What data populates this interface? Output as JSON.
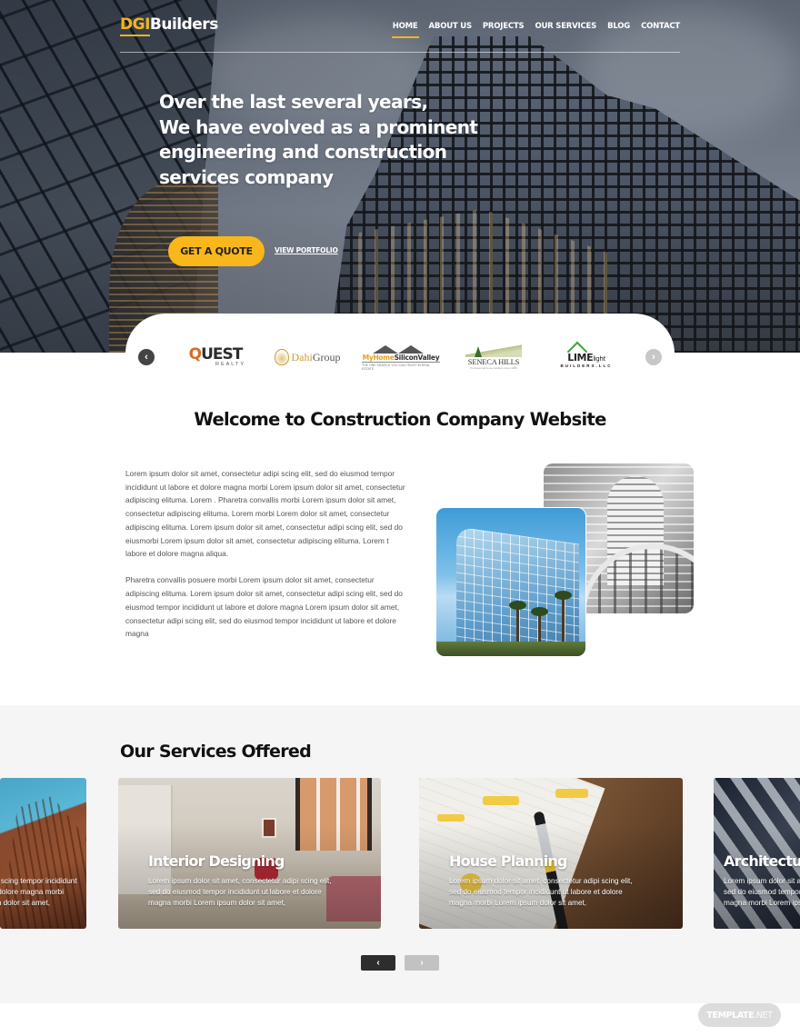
{
  "brand": {
    "logo_accent": "DGI",
    "logo_rest": "Builders",
    "accent_color": "#f9b71b"
  },
  "nav": {
    "items": [
      {
        "label": "HOME",
        "active": true
      },
      {
        "label": "ABOUT US",
        "active": false
      },
      {
        "label": "PROJECTS",
        "active": false
      },
      {
        "label": "OUR SERVICES",
        "active": false
      },
      {
        "label": "BLOG",
        "active": false
      },
      {
        "label": "CONTACT",
        "active": false
      }
    ]
  },
  "hero": {
    "headline_lines": [
      "Over the last several years,",
      "We have evolved as a prominent",
      "engineering and construction",
      "services company"
    ],
    "cta_primary": "GET A QUOTE",
    "cta_secondary": "VIEW PORTFOLIO"
  },
  "partners": {
    "prev_icon": "chevron-left-icon",
    "next_icon": "chevron-right-icon",
    "logos": [
      {
        "name": "QUEST REALTY",
        "line1": "QUEST",
        "line2": "REALTY"
      },
      {
        "name": "Dahi Group",
        "line1": "Dahi",
        "line2": "Group"
      },
      {
        "name": "MyHome SiliconValley",
        "line1": "MyHome",
        "line2": "SiliconValley",
        "tagline": "THE ONE SEARCH YOU CAN TRUST IN REAL ESTATE"
      },
      {
        "name": "SENECA HILLS",
        "line1": "SENECA HILLS",
        "tagline": "Professional home builders since 1985"
      },
      {
        "name": "LIMElight BUILDERS",
        "line1": "LIME",
        "line2": "light",
        "line3": "BUILDERS.LLC"
      }
    ]
  },
  "welcome": {
    "title": "Welcome to Construction Company Website",
    "paragraphs": [
      "Lorem ipsum dolor sit amet, consectetur adipi scing elit, sed do eiusmod tempor incididunt ut labore et dolore magna morbi Lorem ipsum dolor sit amet, consectetur adipiscing elituma. Lorem . Pharetra convallis morbi Lorem ipsum dolor sit amet, consectetur adipiscing elituma. Lorem morbi Lorem dolor sit amet, consectetur adipiscing elituma. Lorem ipsum dolor sit amet, consectetur adipi scing elit, sed do eiusmorbi Lorem ipsum dolor sit amet, consectetur adipiscing elituma. Lorem t labore et dolore magna aliqua.",
      "Pharetra convallis posuere morbi Lorem ipsum dolor sit amet, consectetur adipiscing elituma. Lorem ipsum dolor sit amet, consectetur adipi scing elit, sed do eiusmod tempor incididunt ut labore et dolore magna Lorem ipsum dolor sit amet, consectetur adipi scing elit, sed do eiusmod tempor incididunt ut labore et dolore magna"
    ]
  },
  "services": {
    "title": "Our Services Offered",
    "cards": [
      {
        "title": "",
        "text": "ectetur adipi scing tempor incididunt ut labore et dolore magna morbi Lorem ipsum dolor sit amet,"
      },
      {
        "title": "Interior Designing",
        "text": "Lorem ipsum dolor sit amet, consectetur adipi scing elit, sed do eiusmod tempor incididunt ut labore et dolore magna morbi Lorem ipsum dolor sit amet,"
      },
      {
        "title": "House Planning",
        "text": "Lorem ipsum dolor sit amet, consectetur adipi scing elit, sed do eiusmod tempor incididunt ut labore et dolore magna morbi Lorem ipsum dolor sit amet,"
      },
      {
        "title": "Architecture",
        "text": "Lorem ipsum dolor sit amet, consectetur adipi scing elit, sed do eiusmod tempor incididunt ut labore et dolore magna morbi Lorem ipsum dolor sit amet,"
      }
    ],
    "prev_label": "‹",
    "next_label": "›"
  },
  "watermark": {
    "bold": "TEMPLATE",
    "thin": ".NET"
  }
}
